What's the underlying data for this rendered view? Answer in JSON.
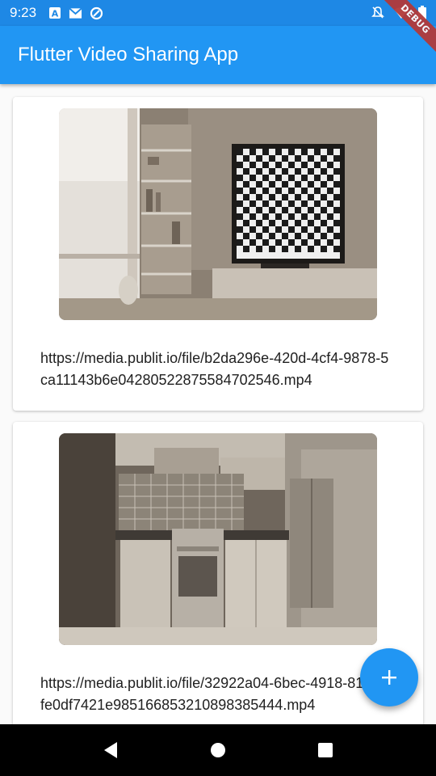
{
  "status_bar": {
    "time": "9:23",
    "icons": [
      "a-notification-icon",
      "gmail-icon",
      "sync-icon",
      "do-not-disturb-icon",
      "wifi-icon",
      "battery-icon"
    ]
  },
  "debug_banner": "DEBUG",
  "app_bar": {
    "title": "Flutter Video Sharing App",
    "color": "#2196f3"
  },
  "videos": [
    {
      "url": "https://media.publit.io/file/b2da296e-420d-4cf4-9878-5ca11143b6e04280522875584702546.mp4",
      "thumbnail": "living-room-with-checkered-tv"
    },
    {
      "url": "https://media.publit.io/file/32922a04-6bec-4918-8138-4fe0df7421e985166853210898385444.mp4",
      "thumbnail": "kitchen-with-stove-and-fridge"
    }
  ],
  "fab": {
    "icon": "plus-icon"
  },
  "nav_bar": {
    "icons": [
      "back-icon",
      "home-icon",
      "recents-icon"
    ]
  }
}
